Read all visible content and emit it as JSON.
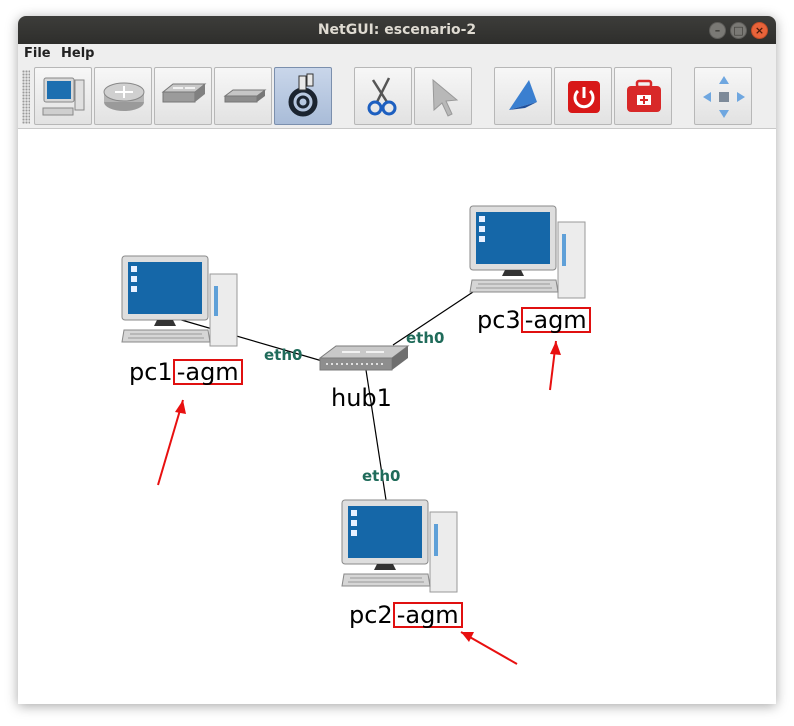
{
  "window": {
    "title": "NetGUI: escenario-2"
  },
  "window_buttons": {
    "minimize": "–",
    "maximize": "□",
    "close": "×"
  },
  "menu": {
    "file": "File",
    "help": "Help"
  },
  "toolbar": {
    "tools": [
      {
        "name": "terminal",
        "icon": "computer-icon"
      },
      {
        "name": "router",
        "icon": "router-icon"
      },
      {
        "name": "switch",
        "icon": "switch-icon"
      },
      {
        "name": "hub",
        "icon": "hub-icon"
      },
      {
        "name": "link",
        "icon": "cable-icon",
        "active": true
      },
      {
        "name": "cut",
        "icon": "scissors-icon"
      },
      {
        "name": "select",
        "icon": "pointer-icon"
      },
      {
        "name": "start",
        "icon": "start-icon"
      },
      {
        "name": "stop",
        "icon": "power-icon"
      },
      {
        "name": "kit",
        "icon": "first-aid-icon"
      },
      {
        "name": "move",
        "icon": "move-arrows-icon"
      }
    ]
  },
  "nodes": {
    "pc1": {
      "prefix": "pc1",
      "suffix": "-agm"
    },
    "pc2": {
      "prefix": "pc2",
      "suffix": "-agm"
    },
    "pc3": {
      "prefix": "pc3",
      "suffix": "-agm"
    },
    "hub1": {
      "name": "hub1"
    }
  },
  "interfaces": {
    "pc1": "eth0",
    "pc2": "eth0",
    "pc3": "eth0"
  },
  "colors": {
    "highlight": "#e01010",
    "arrow": "#e81010",
    "iface": "#1f6b5a",
    "titlebar": "#2e2e2c"
  }
}
